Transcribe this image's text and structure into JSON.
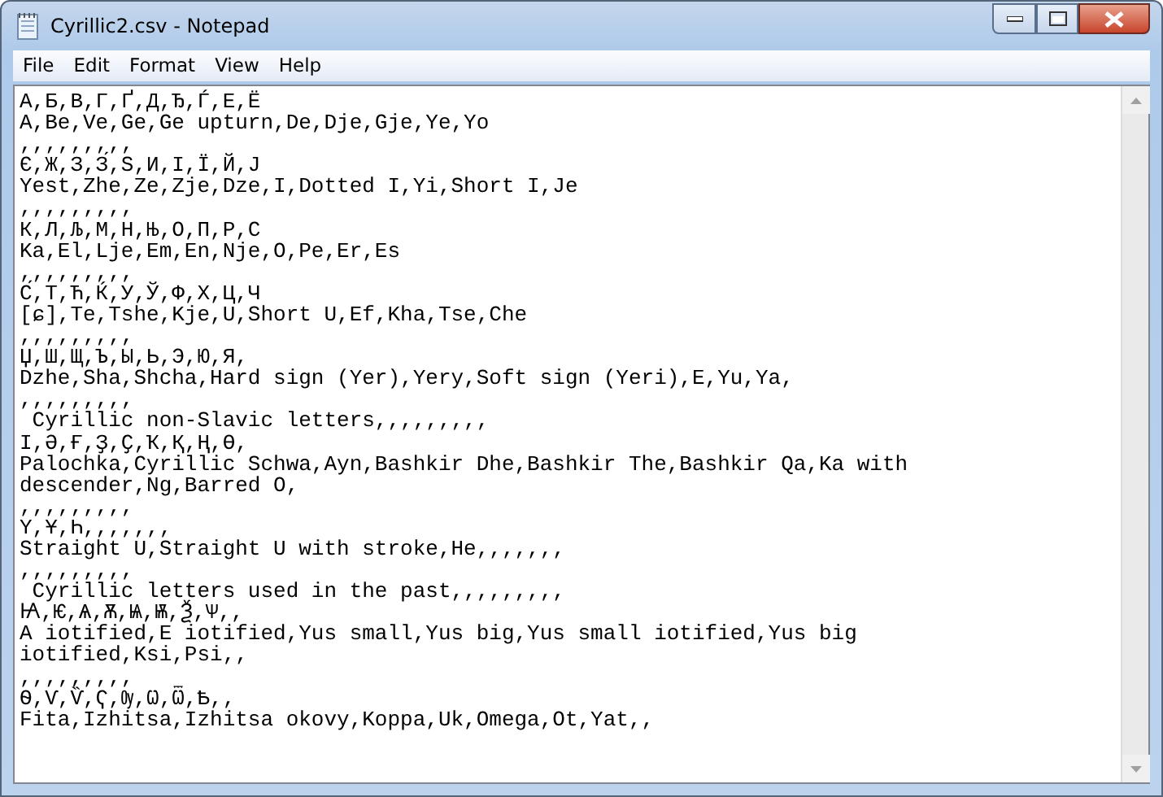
{
  "window": {
    "title": "Cyrillic2.csv - Notepad"
  },
  "menu": [
    "File",
    "Edit",
    "Format",
    "View",
    "Help"
  ],
  "lines": [
    "А,Б,В,Г,Ґ,Д,Ђ,Ѓ,Е,Ё",
    "A,Be,Ve,Ge,Ge upturn,De,Dje,Gje,Ye,Yo",
    ",,,,,,,,,",
    "Є,Ж,З,З́,Ѕ,И,І,Ї,Й,Ј",
    "Yest,Zhe,Ze,Zje,Dze,I,Dotted I,Yi,Short I,Je",
    ",,,,,,,,,",
    "К,Л,Љ,М,Н,Њ,О,П,Р,С",
    "Ka,El,Lje,Em,En,Nje,O,Pe,Er,Es",
    ",,,,,,,,,",
    "С́,Т,Ћ,Ќ,У,Ў,Ф,Х,Ц,Ч",
    "[ɕ],Te,Tshe,Kje,U,Short U,Ef,Kha,Tse,Che",
    ",,,,,,,,,",
    "Џ,Ш,Щ,Ъ,Ы,Ь,Э,Ю,Я,",
    "Dzhe,Sha,Shcha,Hard sign (Yer),Yery,Soft sign (Yeri),E,Yu,Ya,",
    ",,,,,,,,,",
    " Cyrillic non-Slavic letters,,,,,,,,,",
    "Ӏ,Ә,Ғ,Ҙ,Ҫ,Ҡ,Қ,Ң,Ө,",
    "Palochka,Cyrillic Schwa,Ayn,Bashkir Dhe,Bashkir The,Bashkir Qa,Ka with",
    "descender,Ng,Barred O,",
    ",,,,,,,,,",
    "Ү,Ұ,Һ,,,,,,,",
    "Straight U,Straight U with stroke,He,,,,,,,",
    ",,,,,,,,,",
    " Cyrillic letters used in the past,,,,,,,,,",
    "Ꙗ,Ѥ,Ѧ,Ѫ,Ѩ,Ѭ,Ѯ,Ѱ,,",
    "A iotified,E iotified,Yus small,Yus big,Yus small iotified,Yus big",
    "iotified,Ksi,Psi,,",
    ",,,,,,,,,",
    "Ѳ,Ѵ,Ѷ,Ҁ,Ѹ,Ѡ,Ѿ,Ѣ,,",
    "Fita,Izhitsa,Izhitsa okovy,Koppa,Uk,Omega,Ot,Yat,,"
  ]
}
